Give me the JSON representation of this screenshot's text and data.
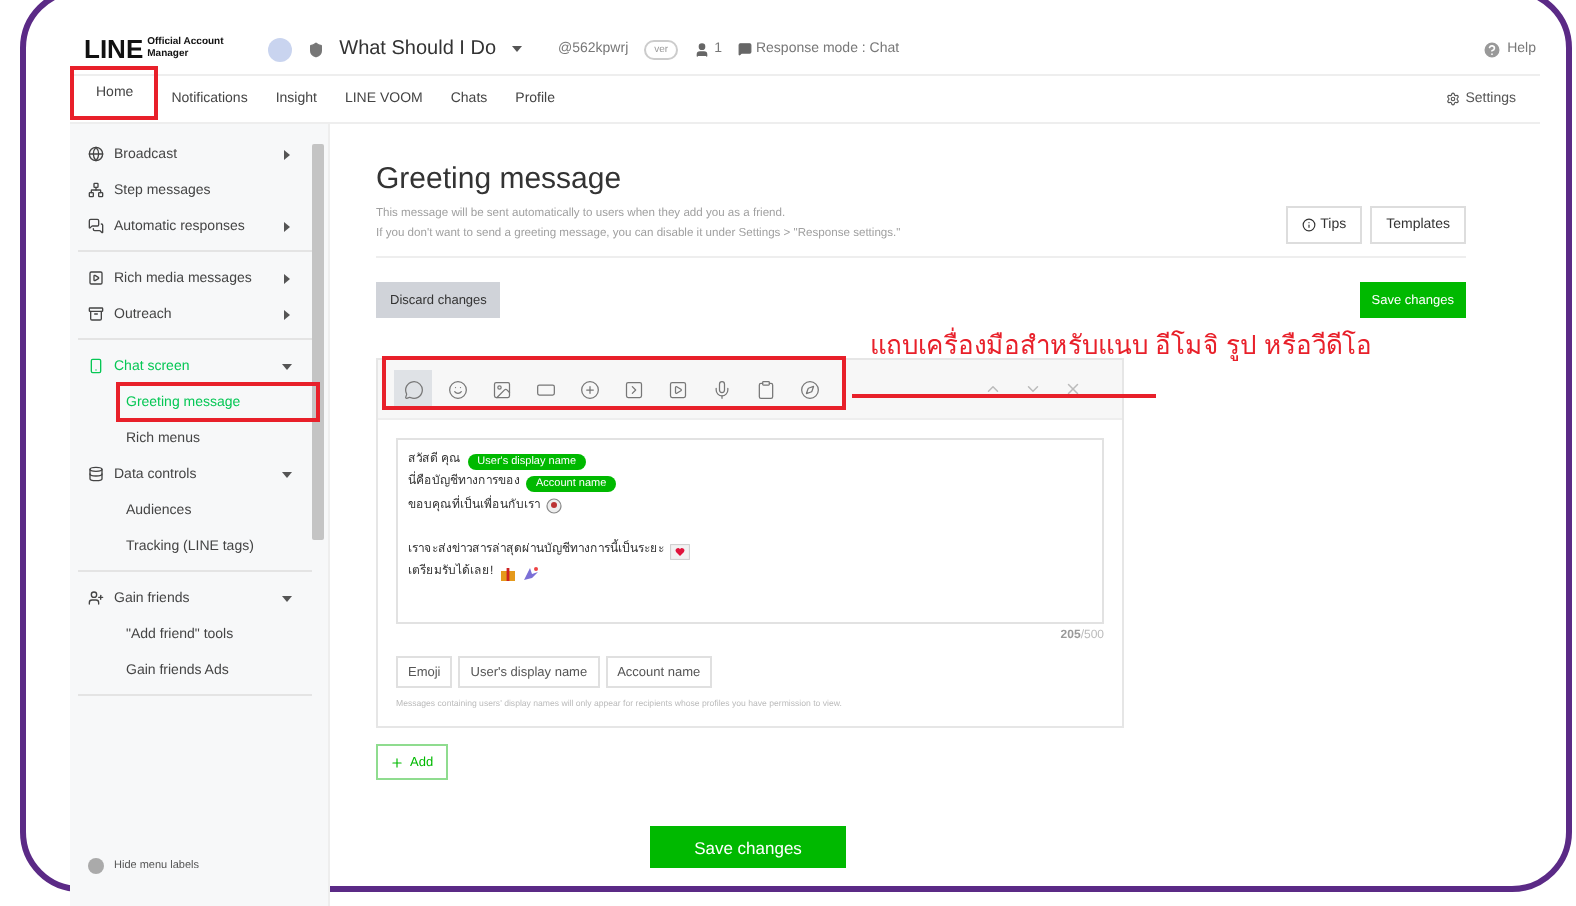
{
  "header": {
    "logo": "LINE",
    "logo_sub": "Official Account Manager",
    "account_name": "What Should I Do",
    "account_id": "@562kpwrj",
    "plan_badge": "ver",
    "friends": "1",
    "response_mode": "Response mode : Chat",
    "help": "Help"
  },
  "nav": {
    "tabs": [
      {
        "label": "Home",
        "selected": false,
        "highlighted": true
      },
      {
        "label": "Notifications",
        "selected": false,
        "highlighted": false
      },
      {
        "label": "Insight",
        "selected": false,
        "highlighted": false
      },
      {
        "label": "LINE VOOM",
        "selected": false,
        "highlighted": false
      },
      {
        "label": "Chats",
        "selected": false,
        "highlighted": false
      },
      {
        "label": "Profile",
        "selected": false,
        "highlighted": false
      }
    ],
    "settings": "Settings"
  },
  "sidebar": {
    "sections": [
      [
        {
          "label": "Broadcast",
          "selected": false,
          "expanded": false
        },
        {
          "label": "Step messages",
          "selected": false
        },
        {
          "label": "Automatic responses",
          "selected": false,
          "expanded": false
        }
      ],
      [
        {
          "label": "Rich media messages",
          "selected": false,
          "expanded": false
        },
        {
          "label": "Outreach",
          "selected": false,
          "expanded": false
        }
      ],
      [
        {
          "label": "Chat screen",
          "selected": true,
          "expanded": true,
          "children": [
            {
              "label": "Greeting message",
              "selected": true,
              "highlighted": true
            },
            {
              "label": "Rich menus",
              "selected": false,
              "highlighted": false
            }
          ]
        },
        {
          "label": "Data controls",
          "selected": false,
          "expanded": true,
          "children": [
            {
              "label": "Audiences",
              "selected": false,
              "highlighted": false
            },
            {
              "label": "Tracking (LINE tags)",
              "selected": false,
              "highlighted": false
            }
          ]
        }
      ],
      [
        {
          "label": "Gain friends",
          "selected": false,
          "expanded": true,
          "children": [
            {
              "label": "\"Add friend\" tools",
              "selected": false,
              "highlighted": false
            },
            {
              "label": "Gain friends Ads",
              "selected": false,
              "highlighted": false
            }
          ]
        }
      ]
    ],
    "hide_labels": "Hide menu labels"
  },
  "page": {
    "title": "Greeting message",
    "description": [
      "This message will be sent automatically to users when they add you as a friend.",
      "If you don't want to send a greeting message, you can disable it under Settings > \"Response settings.\""
    ],
    "tips": "Tips",
    "templates": "Templates",
    "discard": "Discard changes",
    "save_top": "Save changes"
  },
  "editor": {
    "toolbar_highlighted": true,
    "tools": [
      {
        "selected": true
      },
      {
        "selected": false
      },
      {
        "selected": false
      },
      {
        "selected": false
      },
      {
        "selected": false
      },
      {
        "selected": false
      },
      {
        "selected": false
      },
      {
        "selected": false
      },
      {
        "selected": false
      },
      {
        "selected": false
      }
    ],
    "paragraphs": [
      [
        {
          "text": "สวัสดี คุณ",
          "tag": "User's display name"
        },
        {
          "text": "นี่คือบัญชีทางการของ",
          "tag": "Account name"
        },
        {
          "text": "ขอบคุณที่เป็นเพื่อนกับเรา"
        }
      ],
      [
        {
          "text": "เราจะส่งข่าวสารล่าสุดผ่านบัญชีทางการนี้เป็นระยะ"
        },
        {
          "text": "เตรียมรับได้เลย!"
        }
      ]
    ],
    "counter_used": "205",
    "counter_max": "/500",
    "insert_buttons": [
      "Emoji",
      "User's display name",
      "Account name"
    ],
    "note": "Messages containing users' display names will only appear for recipients whose profiles you have permission to view."
  },
  "add": "Add",
  "save_bottom": "Save changes",
  "annotation": {
    "caption": "แถบเครื่องมือสำหรับแนบ อีโมจิ รูป หรือวีดีโอ"
  }
}
